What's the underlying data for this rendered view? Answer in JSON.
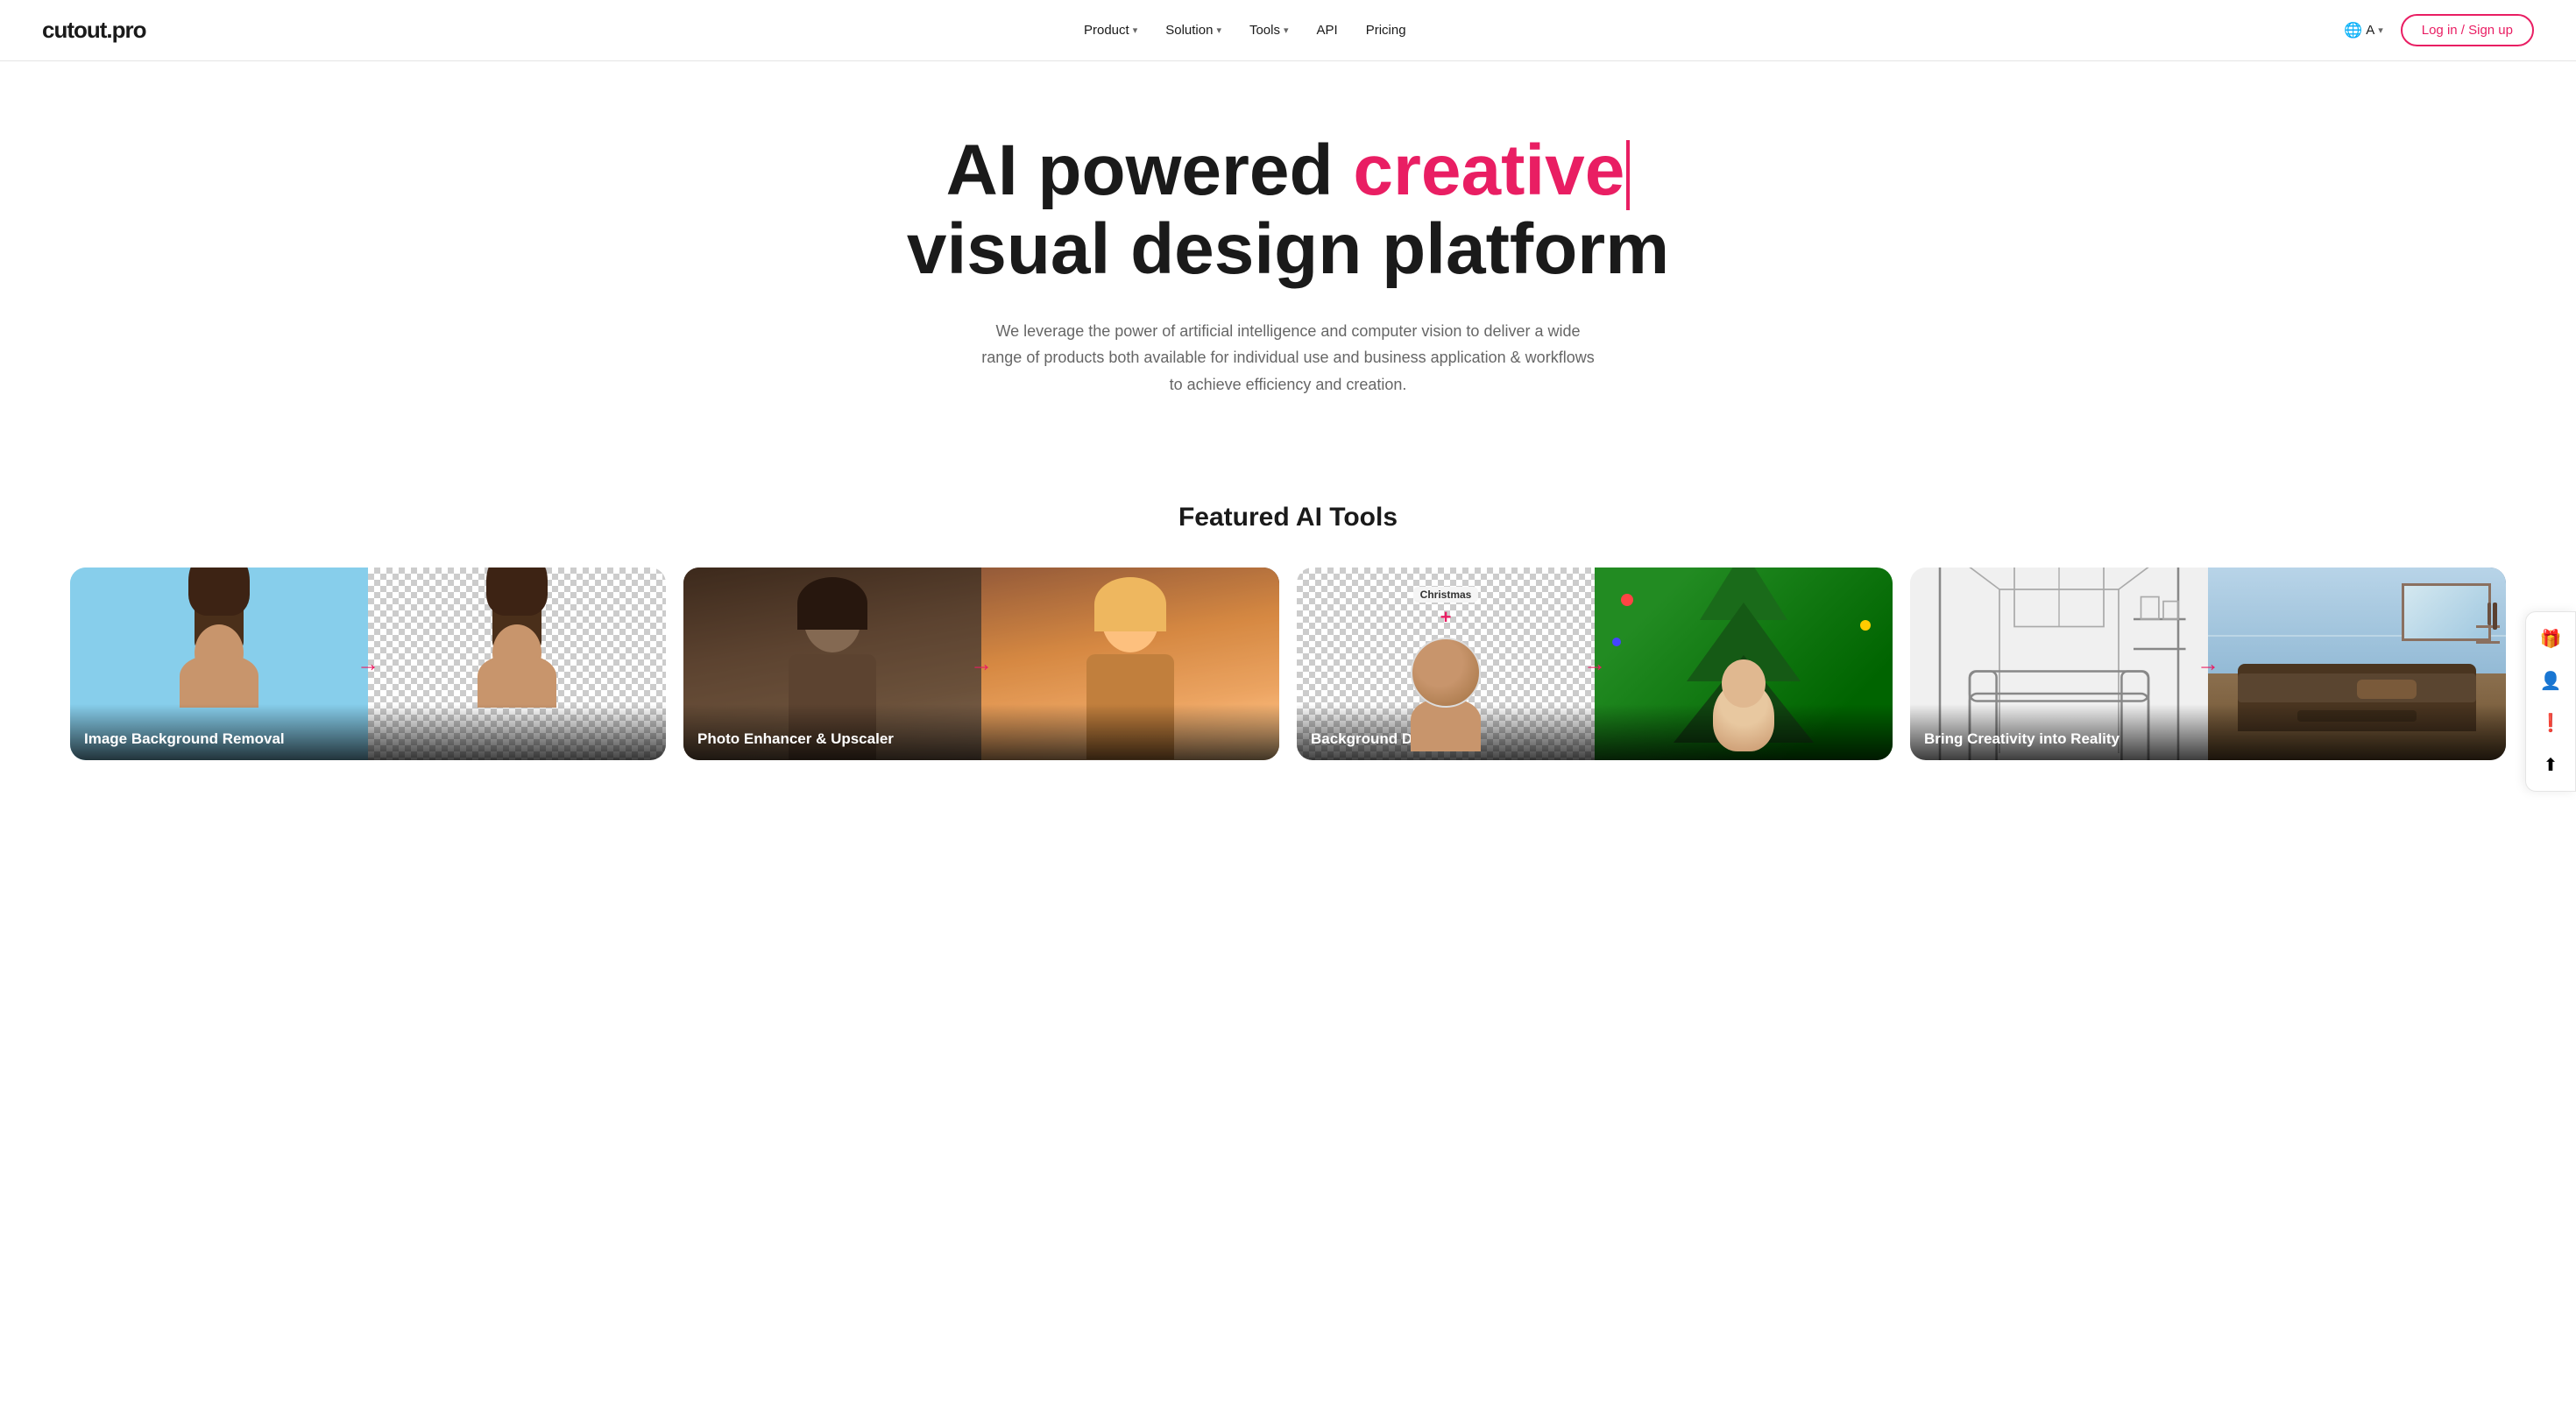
{
  "nav": {
    "logo": "cutout.pro",
    "links": [
      {
        "label": "Product",
        "has_dropdown": true
      },
      {
        "label": "Solution",
        "has_dropdown": true
      },
      {
        "label": "Tools",
        "has_dropdown": true
      },
      {
        "label": "API",
        "has_dropdown": false
      },
      {
        "label": "Pricing",
        "has_dropdown": false
      }
    ],
    "lang_icon": "🌐",
    "lang_label": "A",
    "login_label": "Log in / Sign up"
  },
  "hero": {
    "title_prefix": "AI powered ",
    "title_highlight": "creative",
    "title_suffix": "visual design platform",
    "cursor_visible": true,
    "subtitle": "We leverage the power of artificial intelligence and computer vision to deliver a wide range of products both available for individual use and business application & workflows to achieve efficiency and creation."
  },
  "featured": {
    "section_title": "Featured AI Tools",
    "tools": [
      {
        "id": "tool-bg-removal",
        "label": "Image Background Removal"
      },
      {
        "id": "tool-photo-enhancer",
        "label": "Photo Enhancer & Upscaler"
      },
      {
        "id": "tool-bg-diffusion",
        "label": "Background Diffusion",
        "badge": "Christmas",
        "badge_plus": "+"
      },
      {
        "id": "tool-creativity",
        "label": "Bring Creativity into Reality"
      }
    ]
  },
  "sidebar": {
    "icons": [
      {
        "name": "gift-icon",
        "symbol": "🎁",
        "label": "Gift"
      },
      {
        "name": "avatar-icon",
        "symbol": "👤",
        "label": "Avatar"
      },
      {
        "name": "alert-icon",
        "symbol": "❗",
        "label": "Alert"
      },
      {
        "name": "upload-icon",
        "symbol": "⬆",
        "label": "Upload"
      }
    ]
  }
}
